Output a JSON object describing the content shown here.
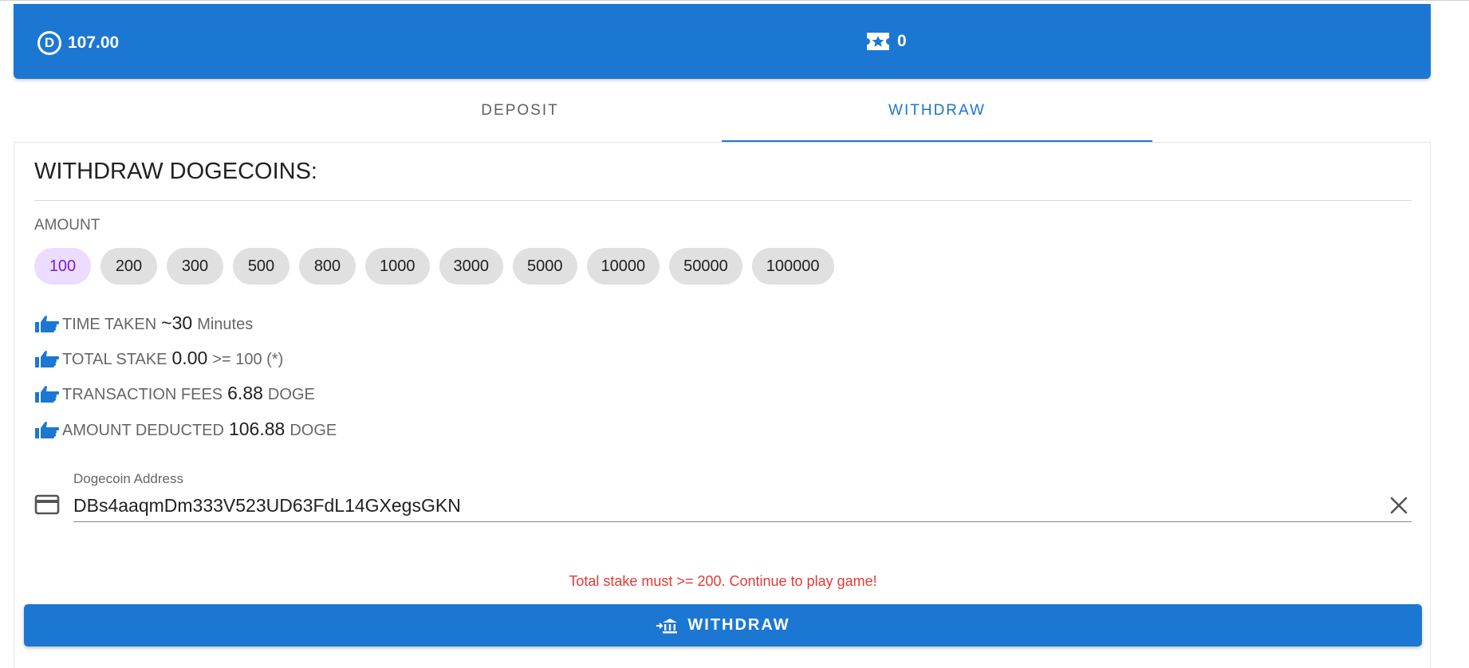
{
  "balances": {
    "doge_symbol": "D",
    "doge_amount": "107.00",
    "ticket_count": "0"
  },
  "tabs": [
    {
      "label": "DEPOSIT",
      "active": false
    },
    {
      "label": "WITHDRAW",
      "active": true
    }
  ],
  "withdraw": {
    "title": "WITHDRAW DOGECOINS:",
    "amount_label": "AMOUNT",
    "amount_options": [
      "100",
      "200",
      "300",
      "500",
      "800",
      "1000",
      "3000",
      "5000",
      "10000",
      "50000",
      "100000"
    ],
    "selected_amount": "100",
    "info": {
      "time_taken": {
        "label": "TIME TAKEN",
        "value": "~30",
        "suffix": "Minutes"
      },
      "total_stake": {
        "label": "TOTAL STAKE",
        "value": "0.00",
        "suffix": ">= 100 (*)"
      },
      "transaction_fees": {
        "label": "TRANSACTION FEES",
        "value": "6.88",
        "suffix": "DOGE"
      },
      "amount_deducted": {
        "label": "AMOUNT DEDUCTED",
        "value": "106.88",
        "suffix": "DOGE"
      }
    },
    "address_label": "Dogecoin Address",
    "address_value": "DBs4aaqmDm333V523UD63FdL14GXegsGKN",
    "error_message": "Total stake must >= 200. Continue to play game!",
    "button_label": "WITHDRAW"
  },
  "colors": {
    "primary": "#1c77d2",
    "error": "#e53935",
    "chip_selected_bg": "#ecdcff",
    "chip_selected_text": "#7b1fd0"
  },
  "icons": {
    "doge": "doge-coin-icon",
    "ticket": "ticket-star-icon",
    "info": "thumb-point-icon",
    "address": "credit-card-icon",
    "clear": "close-icon",
    "button": "bank-transfer-icon"
  }
}
